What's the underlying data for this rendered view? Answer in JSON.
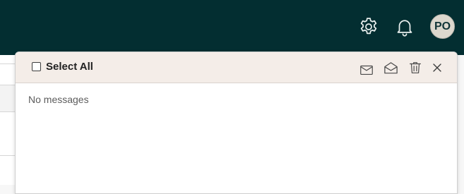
{
  "topbar": {
    "background_color": "#032e31",
    "icons": [
      "gear-icon",
      "bell-icon"
    ],
    "avatar_initials": "PO"
  },
  "panel": {
    "select_all_label": "Select All",
    "select_all_checked": false,
    "header_actions": [
      "mark-unread-icon",
      "mark-read-icon",
      "delete-icon",
      "close-icon"
    ],
    "empty_message": "No messages",
    "header_color": "#f4ede8"
  }
}
